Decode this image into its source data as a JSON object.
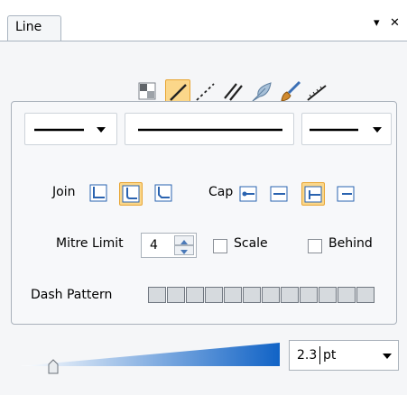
{
  "panel": {
    "tab_title": "Line",
    "menu_glyph": "▾",
    "close_glyph": "✕"
  },
  "toolbar": {
    "tools": [
      "fill-icon",
      "line-tool-icon",
      "dashed-line-icon",
      "double-line-icon",
      "feather-icon",
      "brush-icon",
      "ruler-icon"
    ],
    "active_tool": "line-tool-icon"
  },
  "style_selectors": {
    "start_arrow": "",
    "line_style": "",
    "end_arrow": ""
  },
  "join": {
    "label": "Join",
    "options": [
      "mitre-join-icon",
      "round-join-icon",
      "bevel-join-icon"
    ],
    "selected": "round-join-icon"
  },
  "cap": {
    "label": "Cap",
    "options": [
      "butt-cap-icon",
      "round-cap-icon",
      "square-cap-icon",
      "flat-cap-icon"
    ],
    "selected": "square-cap-icon"
  },
  "mitre": {
    "label": "Mitre Limit",
    "value": "4"
  },
  "scale": {
    "label": "Scale",
    "checked": false
  },
  "behind": {
    "label": "Behind",
    "checked": false
  },
  "dash": {
    "label": "Dash Pattern",
    "cell_count": 12
  },
  "width": {
    "value": "2.3",
    "unit": "pt",
    "slider_fraction": 0.08
  },
  "colors": {
    "accent": "#fbd78a",
    "gradient_start": "#ffffff",
    "gradient_end": "#1163c6"
  }
}
